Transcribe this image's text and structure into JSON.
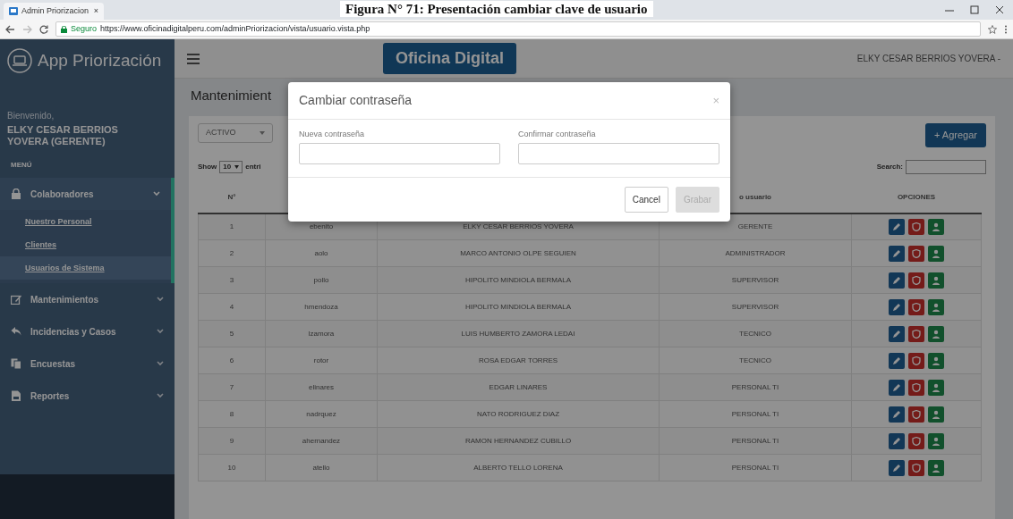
{
  "document_caption": "Figura N° 71: Presentación cambiar clave de usuario",
  "browser": {
    "tab_title": "Admin Priorizacion",
    "tab_close": "×",
    "secure_label": "Seguro",
    "url": "https://www.oficinadigitalperu.com/adminPriorizacion/vista/usuario.vista.php"
  },
  "sidebar": {
    "app_title": "App Priorización",
    "greeting": "Bienvenido,",
    "user": "ELKY CESAR BERRIOS YOVERA (GERENTE)",
    "menu_label": "MENÚ",
    "items": [
      {
        "label": "Colaboradores",
        "kind": "lock",
        "expanded": true,
        "children": [
          {
            "label": "Nuestro Personal",
            "selected": false
          },
          {
            "label": "Clientes",
            "selected": false
          },
          {
            "label": "Usuarios de Sistema",
            "selected": true
          }
        ]
      },
      {
        "label": "Mantenimientos",
        "kind": "edit",
        "expanded": false
      },
      {
        "label": "Incidencias y Casos",
        "kind": "reply",
        "expanded": false
      },
      {
        "label": "Encuestas",
        "kind": "copy",
        "expanded": false
      },
      {
        "label": "Reportes",
        "kind": "file",
        "expanded": false
      }
    ]
  },
  "topbar": {
    "logo_text": "Oficina Digital",
    "user_menu": "ELKY CESAR BERRIOS YOVERA -"
  },
  "page": {
    "title": "Mantenimient",
    "status_filter": "ACTIVO",
    "show_label": "Show",
    "page_size": "10",
    "entries_label": "entri",
    "add_button": "+ Agregar",
    "search_label": "Search:"
  },
  "table": {
    "columns": [
      "N°",
      null,
      null,
      "o usuario",
      "OPCIONES"
    ],
    "rows": [
      {
        "cells": [
          "1",
          "ebenito",
          "ELKY CESAR BERRIOS YOVERA",
          "GERENTE"
        ]
      },
      {
        "cells": [
          "2",
          "aolo",
          "MARCO ANTONIO OLPE SEGUIEN",
          "ADMINISTRADOR"
        ]
      },
      {
        "cells": [
          "3",
          "pollo",
          "HIPOLITO MINDIOLA BERMALA",
          "SUPERVISOR"
        ]
      },
      {
        "cells": [
          "4",
          "hmendoza",
          "HIPOLITO MINDIOLA BERMALA",
          "SUPERVISOR"
        ]
      },
      {
        "cells": [
          "5",
          "lzamora",
          "LUIS HUMBERTO ZAMORA LEDAI",
          "TECNICO"
        ]
      },
      {
        "cells": [
          "6",
          "rotor",
          "ROSA EDGAR TORRES",
          "TECNICO"
        ]
      },
      {
        "cells": [
          "7",
          "elinares",
          "EDGAR LINARES",
          "PERSONAL TI"
        ]
      },
      {
        "cells": [
          "8",
          "nadrquez",
          "NATO RODRIGUEZ DIAZ",
          "PERSONAL TI"
        ]
      },
      {
        "cells": [
          "9",
          "ahernandez",
          "RAMON HERNANDEZ CUBILLO",
          "PERSONAL TI"
        ]
      },
      {
        "cells": [
          "10",
          "atello",
          "ALBERTO TELLO LORENA",
          "PERSONAL TI"
        ]
      }
    ]
  },
  "modal": {
    "title": "Cambiar contraseña",
    "close": "×",
    "fields": [
      {
        "label": "Nueva contraseña"
      },
      {
        "label": "Confirmar contraseña"
      }
    ],
    "buttons": [
      {
        "label": "Cancel",
        "disabled": false
      },
      {
        "label": "Grabar",
        "disabled": true
      }
    ]
  }
}
